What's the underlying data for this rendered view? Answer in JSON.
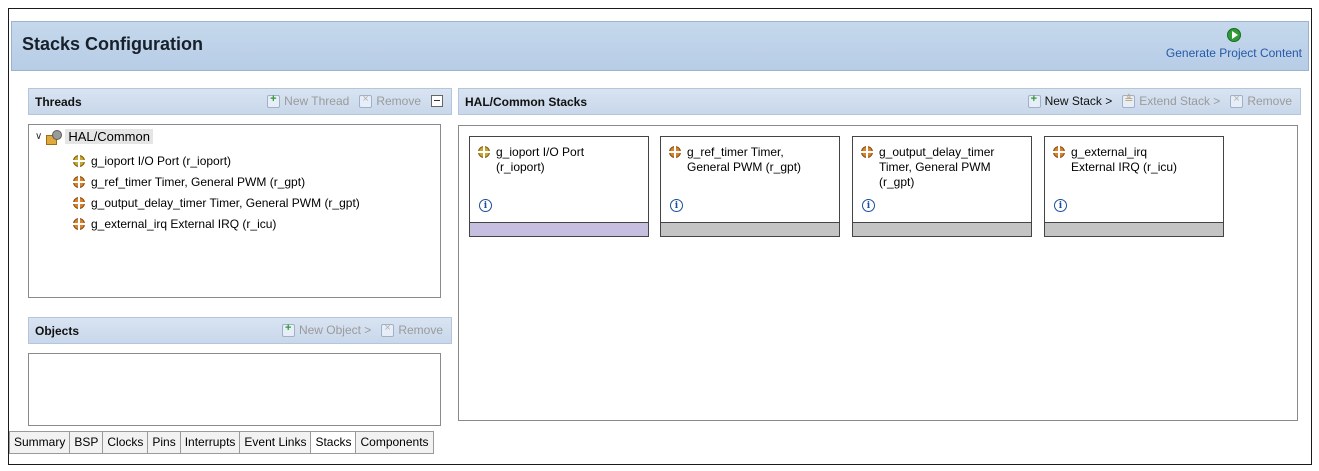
{
  "header": {
    "title": "Stacks Configuration",
    "generate_label": "Generate Project Content",
    "generate_icon": "play-circle-icon"
  },
  "threads": {
    "title": "Threads",
    "new_thread_label": "New Thread",
    "remove_label": "Remove",
    "root": "HAL/Common",
    "items": [
      "g_ioport I/O Port (r_ioport)",
      "g_ref_timer Timer, General PWM (r_gpt)",
      "g_output_delay_timer Timer, General PWM (r_gpt)",
      "g_external_irq External IRQ (r_icu)"
    ]
  },
  "objects": {
    "title": "Objects",
    "new_object_label": "New Object >",
    "remove_label": "Remove"
  },
  "stacks": {
    "title": "HAL/Common Stacks",
    "new_stack_label": "New Stack >",
    "extend_stack_label": "Extend Stack >",
    "remove_label": "Remove",
    "cards": [
      {
        "line1": "g_ioport I/O Port",
        "line2": "(r_ioport)",
        "line3": "",
        "footer_color": "#c7bfe0"
      },
      {
        "line1": "g_ref_timer Timer,",
        "line2": "General PWM (r_gpt)",
        "line3": "",
        "footer_color": "#c4c4c4"
      },
      {
        "line1": "g_output_delay_timer",
        "line2": "Timer, General PWM",
        "line3": "(r_gpt)",
        "footer_color": "#c4c4c4"
      },
      {
        "line1": "g_external_irq",
        "line2": "External IRQ (r_icu)",
        "line3": "",
        "footer_color": "#c4c4c4"
      }
    ]
  },
  "tabs": [
    "Summary",
    "BSP",
    "Clocks",
    "Pins",
    "Interrupts",
    "Event Links",
    "Stacks",
    "Components"
  ],
  "active_tab": "Stacks"
}
